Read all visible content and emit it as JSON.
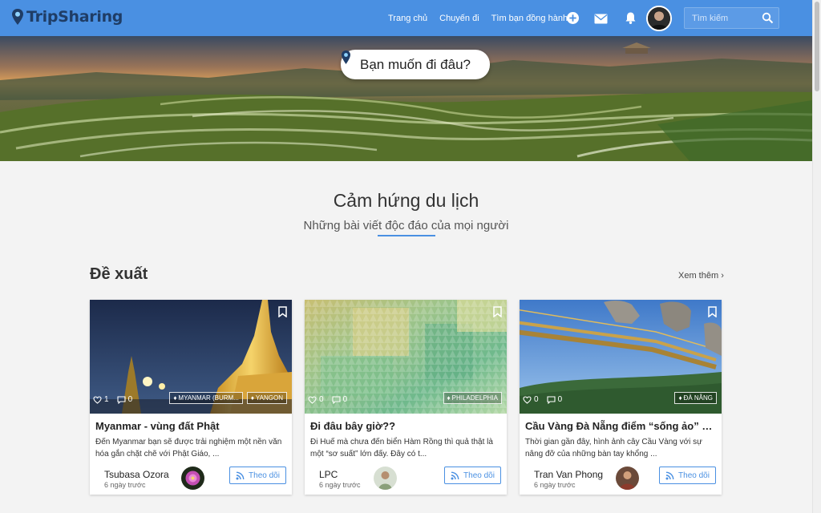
{
  "brand": {
    "name": "TripSharing",
    "logo_icon": "map-pin-icon"
  },
  "nav": {
    "items": [
      "Trang chủ",
      "Chuyến đi",
      "Tìm bạn đồng hành"
    ]
  },
  "header_icons": [
    "plus-circle-icon",
    "mail-icon",
    "bell-icon"
  ],
  "search": {
    "placeholder": "Tìm kiếm"
  },
  "hero": {
    "prompt": "Bạn muốn đi đâu?"
  },
  "section": {
    "title": "Cảm hứng du lịch",
    "subtitle": "Những bài viết độc đáo của mọi người",
    "accent_color": "#4a90e2"
  },
  "recommend": {
    "title": "Đề xuất",
    "see_more": "Xem thêm"
  },
  "colors": {
    "header": "#4a90e2",
    "brand_text": "#1f3d66",
    "follow": "#4a90e2"
  },
  "cards": [
    {
      "likes": "1",
      "comments": "0",
      "tags": [
        "MYANMAR (BURM...",
        "YANGON"
      ],
      "title": "Myanmar - vùng đất Phật",
      "excerpt": "Đến Myanmar bạn sẽ được trải nghiệm một nền văn hóa gắn chặt chẽ với Phật Giáo, ...",
      "author": "Tsubasa Ozora",
      "time": "6 ngày trước",
      "follow": "Theo dõi"
    },
    {
      "likes": "0",
      "comments": "0",
      "tags": [
        "PHILADELPHIA"
      ],
      "title": "Đi đâu bây giờ??",
      "excerpt": "Đi Huế mà chưa đến biển Hàm Rồng thì quả thật là một “sơ suất” lớn đấy. Đây có t...",
      "author": "LPC",
      "time": "6 ngày trước",
      "follow": "Theo dõi"
    },
    {
      "likes": "0",
      "comments": "0",
      "tags": [
        "ĐÀ NẴNG"
      ],
      "title": "Cầu Vàng Đà Nẵng điểm “sống ảo” khiế...",
      "excerpt": "Thời gian gần đây, hình ảnh cây Cầu Vàng với sự nâng đỡ của những bàn tay khổng ...",
      "author": "Tran Van Phong",
      "time": "6 ngày trước",
      "follow": "Theo dõi"
    }
  ]
}
